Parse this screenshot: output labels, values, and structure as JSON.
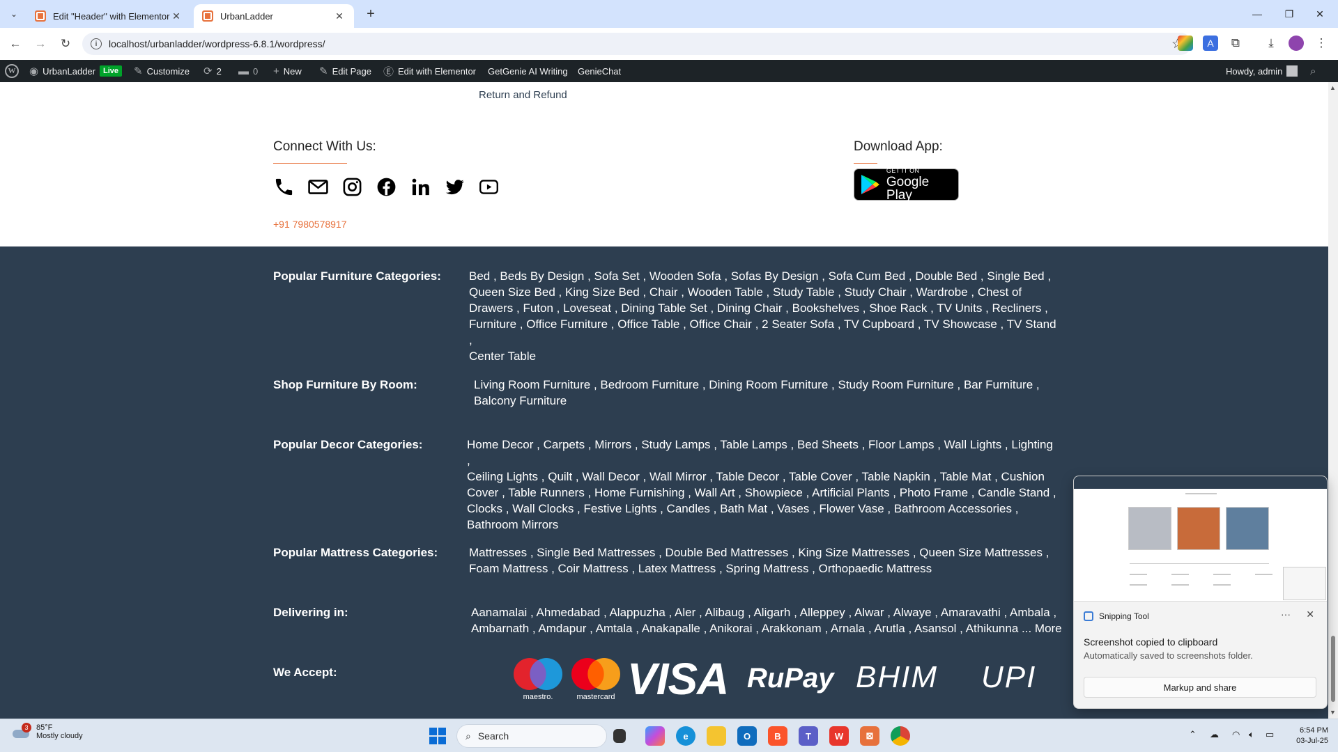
{
  "browser": {
    "tabs": [
      {
        "title": "Edit \"Header\" with Elementor",
        "active": false
      },
      {
        "title": "UrbanLadder",
        "active": true
      }
    ],
    "url": "localhost/urbanladder/wordpress-6.8.1/wordpress/"
  },
  "admin_bar": {
    "site_name": "UrbanLadder",
    "live_badge": "Live",
    "customize": "Customize",
    "updates_count": "2",
    "comments_count": "0",
    "new_label": "New",
    "edit_page": "Edit Page",
    "edit_elementor": "Edit with Elementor",
    "getgenie": "GetGenie AI Writing",
    "geniechat": "GenieChat",
    "howdy": "Howdy, admin"
  },
  "footer_top": {
    "return_link": "Return and Refund",
    "connect_heading": "Connect With Us:",
    "download_heading": "Download App:",
    "phone": "+91 7980578917",
    "social_icons": [
      "phone-icon",
      "mail-icon",
      "instagram-icon",
      "facebook-icon",
      "linkedin-icon",
      "twitter-icon",
      "youtube-icon"
    ],
    "google_play": {
      "small": "GET IT ON",
      "big": "Google Play"
    }
  },
  "categories": {
    "furniture": {
      "label": "Popular Furniture Categories:",
      "lines": [
        "Bed , Beds By Design , Sofa Set , Wooden Sofa , Sofas By Design , Sofa Cum Bed , Double Bed , Single Bed ,",
        "Queen Size Bed , King Size Bed , Chair , Wooden Table , Study Table , Study Chair , Wardrobe , Chest of",
        "Drawers , Futon , Loveseat , Dining Table Set , Dining Chair , Bookshelves , Shoe Rack , TV Units , Recliners ,",
        "Furniture , Office Furniture , Office Table , Office Chair , 2 Seater Sofa , TV Cupboard , TV Showcase , TV Stand ,",
        "Center Table"
      ]
    },
    "room": {
      "label": "Shop Furniture By Room:",
      "lines": [
        "Living Room Furniture , Bedroom Furniture , Dining Room Furniture , Study Room Furniture , Bar Furniture ,",
        "Balcony Furniture"
      ]
    },
    "decor": {
      "label": "Popular Decor Categories:",
      "lines": [
        "Home Decor , Carpets , Mirrors , Study Lamps , Table Lamps , Bed Sheets , Floor Lamps , Wall Lights , Lighting ,",
        "Ceiling Lights , Quilt , Wall Decor , Wall Mirror , Table Decor , Table Cover , Table Napkin , Table Mat , Cushion",
        "Cover , Table Runners , Home Furnishing , Wall Art , Showpiece , Artificial Plants , Photo Frame , Candle Stand ,",
        "Clocks , Wall Clocks , Festive Lights , Candles , Bath Mat , Vases , Flower Vase , Bathroom Accessories ,",
        "Bathroom Mirrors"
      ]
    },
    "mattress": {
      "label": "Popular Mattress Categories:",
      "lines": [
        "Mattresses , Single Bed Mattresses , Double Bed Mattresses , King Size Mattresses , Queen Size Mattresses ,",
        "Foam Mattress , Coir Mattress , Latex Mattress , Spring Mattress , Orthopaedic Mattress"
      ]
    },
    "delivering": {
      "label": "Delivering in:",
      "lines": [
        "Aanamalai , Ahmedabad , Alappuzha , Aler , Alibaug , Aligarh , Alleppey , Alwar , Alwaye , Amaravathi , Ambala ,",
        "Ambarnath , Amdapur , Amtala , Anakapalle , Anikorai , Arakkonam , Arnala , Arutla , Asansol , Athikunna ... More"
      ]
    },
    "accept": {
      "label": "We Accept:",
      "logos": [
        "maestro",
        "mastercard",
        "VISA",
        "RuPay",
        "BHIM",
        "UPI"
      ],
      "maestro_caption": "maestro.",
      "mastercard_caption": "mastercard"
    }
  },
  "notification": {
    "app": "Snipping Tool",
    "title": "Screenshot copied to clipboard",
    "body": "Automatically saved to screenshots folder.",
    "action": "Markup and share"
  },
  "taskbar": {
    "weather_temp": "85°F",
    "weather_desc": "Mostly cloudy",
    "weather_badge": "3",
    "search_placeholder": "Search",
    "time": "6:54 PM",
    "date": "03-Jul-25"
  },
  "colors": {
    "accent": "#e7713c",
    "footer_bg": "#2d3e50",
    "admin_bar": "#1d2327"
  }
}
